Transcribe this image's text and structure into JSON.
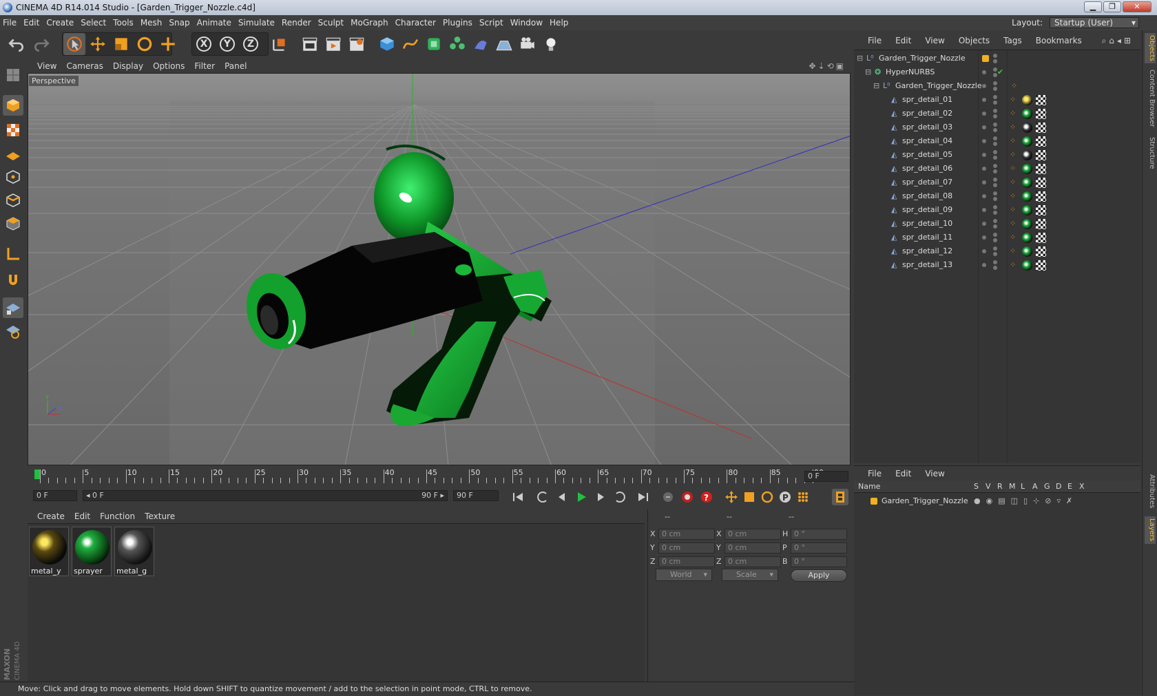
{
  "titlebar": {
    "title": "CINEMA 4D R14.014 Studio - [Garden_Trigger_Nozzle.c4d]"
  },
  "menubar": {
    "items": [
      "File",
      "Edit",
      "Create",
      "Select",
      "Tools",
      "Mesh",
      "Snap",
      "Animate",
      "Simulate",
      "Render",
      "Sculpt",
      "MoGraph",
      "Character",
      "Plugins",
      "Script",
      "Window",
      "Help"
    ],
    "layout_label": "Layout:",
    "layout_value": "Startup (User)"
  },
  "toolbar": {
    "axis_x": "X",
    "axis_y": "Y",
    "axis_z": "Z"
  },
  "viewport": {
    "menu": [
      "View",
      "Cameras",
      "Display",
      "Options",
      "Filter",
      "Panel"
    ],
    "label": "Perspective",
    "axis_y": "Y",
    "axis_z": "Z"
  },
  "timeline": {
    "ticks": [
      "0",
      "5",
      "10",
      "15",
      "20",
      "25",
      "30",
      "35",
      "40",
      "45",
      "50",
      "55",
      "60",
      "65",
      "70",
      "75",
      "80",
      "85",
      "90"
    ],
    "frame_field": "0 F",
    "start_field": "0 F",
    "range_start": "◂ 0 F",
    "range_end": "90 F ▸",
    "end_field": "90 F"
  },
  "materials": {
    "menu": [
      "Create",
      "Edit",
      "Function",
      "Texture"
    ],
    "items": [
      {
        "name": "metal_y"
      },
      {
        "name": "sprayer"
      },
      {
        "name": "metal_g"
      }
    ]
  },
  "coords": {
    "head1": "--",
    "head2": "--",
    "head3": "--",
    "rows": [
      {
        "a": "X",
        "av": "0 cm",
        "b": "X",
        "bv": "0 cm",
        "c": "H",
        "cv": "0 °"
      },
      {
        "a": "Y",
        "av": "0 cm",
        "b": "Y",
        "bv": "0 cm",
        "c": "P",
        "cv": "0 °"
      },
      {
        "a": "Z",
        "av": "0 cm",
        "b": "Z",
        "bv": "0 cm",
        "c": "B",
        "cv": "0 °"
      }
    ],
    "world": "World",
    "scale": "Scale",
    "apply": "Apply"
  },
  "status": {
    "text": "Move: Click and drag to move elements. Hold down SHIFT to quantize movement / add to the selection in point mode, CTRL to remove."
  },
  "objects": {
    "menu": [
      "File",
      "Edit",
      "View",
      "Objects",
      "Tags",
      "Bookmarks"
    ],
    "root": "Garden_Trigger_Nozzle",
    "hypernurbs": "HyperNURBS",
    "group": "Garden_Trigger_Nozzle",
    "children": [
      "spr_detail_01",
      "spr_detail_02",
      "spr_detail_03",
      "spr_detail_04",
      "spr_detail_05",
      "spr_detail_06",
      "spr_detail_07",
      "spr_detail_08",
      "spr_detail_09",
      "spr_detail_10",
      "spr_detail_11",
      "spr_detail_12",
      "spr_detail_13"
    ],
    "child_tags": [
      "metal_y",
      "sprayer",
      "metal_g",
      "sprayer",
      "metal_g",
      "sprayer",
      "sprayer",
      "sprayer",
      "sprayer",
      "sprayer",
      "sprayer",
      "sprayer",
      "sprayer"
    ]
  },
  "layers": {
    "menu": [
      "File",
      "Edit",
      "View"
    ],
    "headers": [
      "Name",
      "S",
      "V",
      "R",
      "M",
      "L",
      "A",
      "G",
      "D",
      "E",
      "X"
    ],
    "row": "Garden_Trigger_Nozzle"
  },
  "righttabs": [
    "Objects",
    "Content Browser",
    "Structure",
    "Attributes",
    "Layers"
  ],
  "colors": {
    "accent": "#f0a020",
    "green": "#1fb83a",
    "metal_y": "#e8d040"
  }
}
